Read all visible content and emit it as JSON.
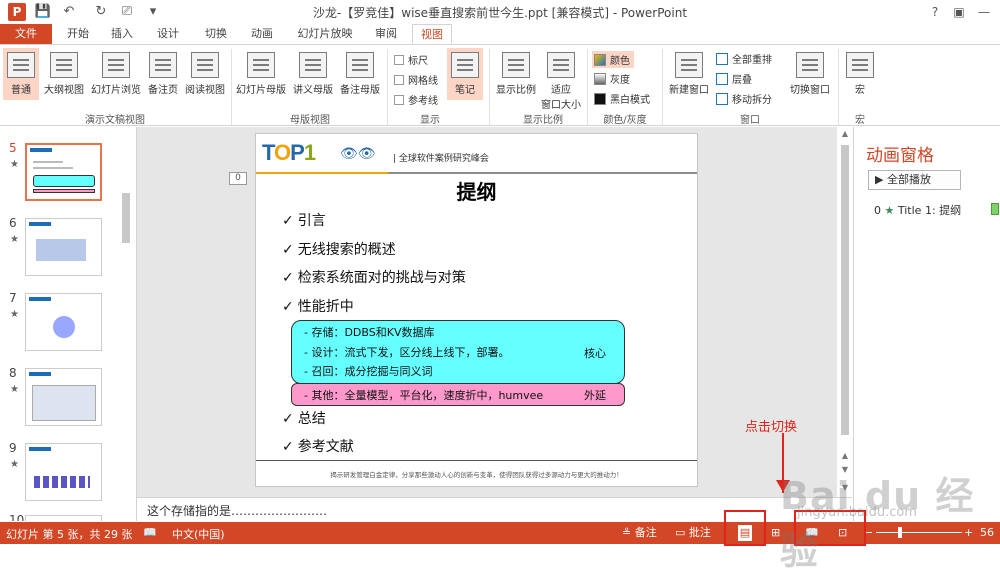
{
  "titlebar": {
    "app_logo": "P",
    "title": "沙龙-【罗竞佳】wise垂直搜索前世今生.ppt [兼容模式] - PowerPoint",
    "help": "?",
    "minimize": "—",
    "close": "✕"
  },
  "tabs": [
    "文件",
    "开始",
    "插入",
    "设计",
    "切换",
    "动画",
    "幻灯片放映",
    "审阅",
    "视图"
  ],
  "ribbon": {
    "views": [
      "普通",
      "大纲视图",
      "幻灯片浏览",
      "备注页",
      "阅读视图"
    ],
    "views_group": "演示文稿视图",
    "masters": [
      "幻灯片母版",
      "讲义母版",
      "备注母版"
    ],
    "masters_group": "母版视图",
    "show": {
      "ruler": "标尺",
      "gridlines": "网格线",
      "guides": "参考线",
      "notes": "笔记"
    },
    "show_group": "显示",
    "zoom": {
      "zoom": "显示比例",
      "fit": "适应",
      "fit2": "窗口大小"
    },
    "zoom_group": "显示比例",
    "color": {
      "color": "颜色",
      "gray": "灰度",
      "bw": "黑白模式"
    },
    "color_group": "颜色/灰度",
    "window": {
      "new": "新建窗口",
      "arrange_all": "全部重排",
      "cascade": "层叠",
      "move_split": "移动拆分",
      "switch": "切换窗口"
    },
    "window_group": "窗口",
    "macro": "宏",
    "macro_group": "宏"
  },
  "thumbnails": [
    {
      "num": "5",
      "star": "★"
    },
    {
      "num": "6",
      "star": "★"
    },
    {
      "num": "7",
      "star": "★"
    },
    {
      "num": "8",
      "star": "★"
    },
    {
      "num": "9",
      "star": "★"
    },
    {
      "num": "10",
      "star": ""
    }
  ],
  "slide": {
    "logo_t": "T",
    "logo_o": "O",
    "logo_p": "P",
    "logo_1": "1",
    "eyes": "👁👁",
    "org": "| 全球软件案例研究峰会",
    "title": "提纲",
    "bullets": [
      "引言",
      "无线搜索的概述",
      "检索系统面对的挑战与对策",
      "性能折中",
      "总结",
      "参考文献"
    ],
    "checkmark": "✓",
    "cyan_lines": [
      "- 存储：DDBS和KV数据库",
      "- 设计：流式下发，区分线上线下，部署。",
      "- 召回：成分挖掘与同义词"
    ],
    "cyan_right": "核心",
    "pink_line": "- 其他：全量模型，平台化，速度折中，humvee",
    "pink_right": "外延",
    "footer": "揭示研发管理白金定律，分享那些激动人心的创新与变革，使得团队获得过多源动力与更大的推动力！"
  },
  "slide_indicator": "0",
  "notes_text": "这个存储指的是……………………",
  "animation_pane": {
    "title": "动画窗格",
    "play_all": "全部播放",
    "item_num": "0",
    "item_label": "Title 1: 提纲"
  },
  "annotation": "点击切换",
  "watermark": "Bai du 经验",
  "watermark2": "jingyan.baidu.com",
  "status": {
    "slide_info": "幻灯片 第 5 张，共 29 张",
    "language": "中文(中国)",
    "notes": "备注",
    "comments": "批注",
    "zoom": "56"
  },
  "colors": {
    "accent": "#d24726",
    "cyan_box": "#66ffff",
    "pink_box": "#ff99cc",
    "annotation": "#e2231a"
  }
}
